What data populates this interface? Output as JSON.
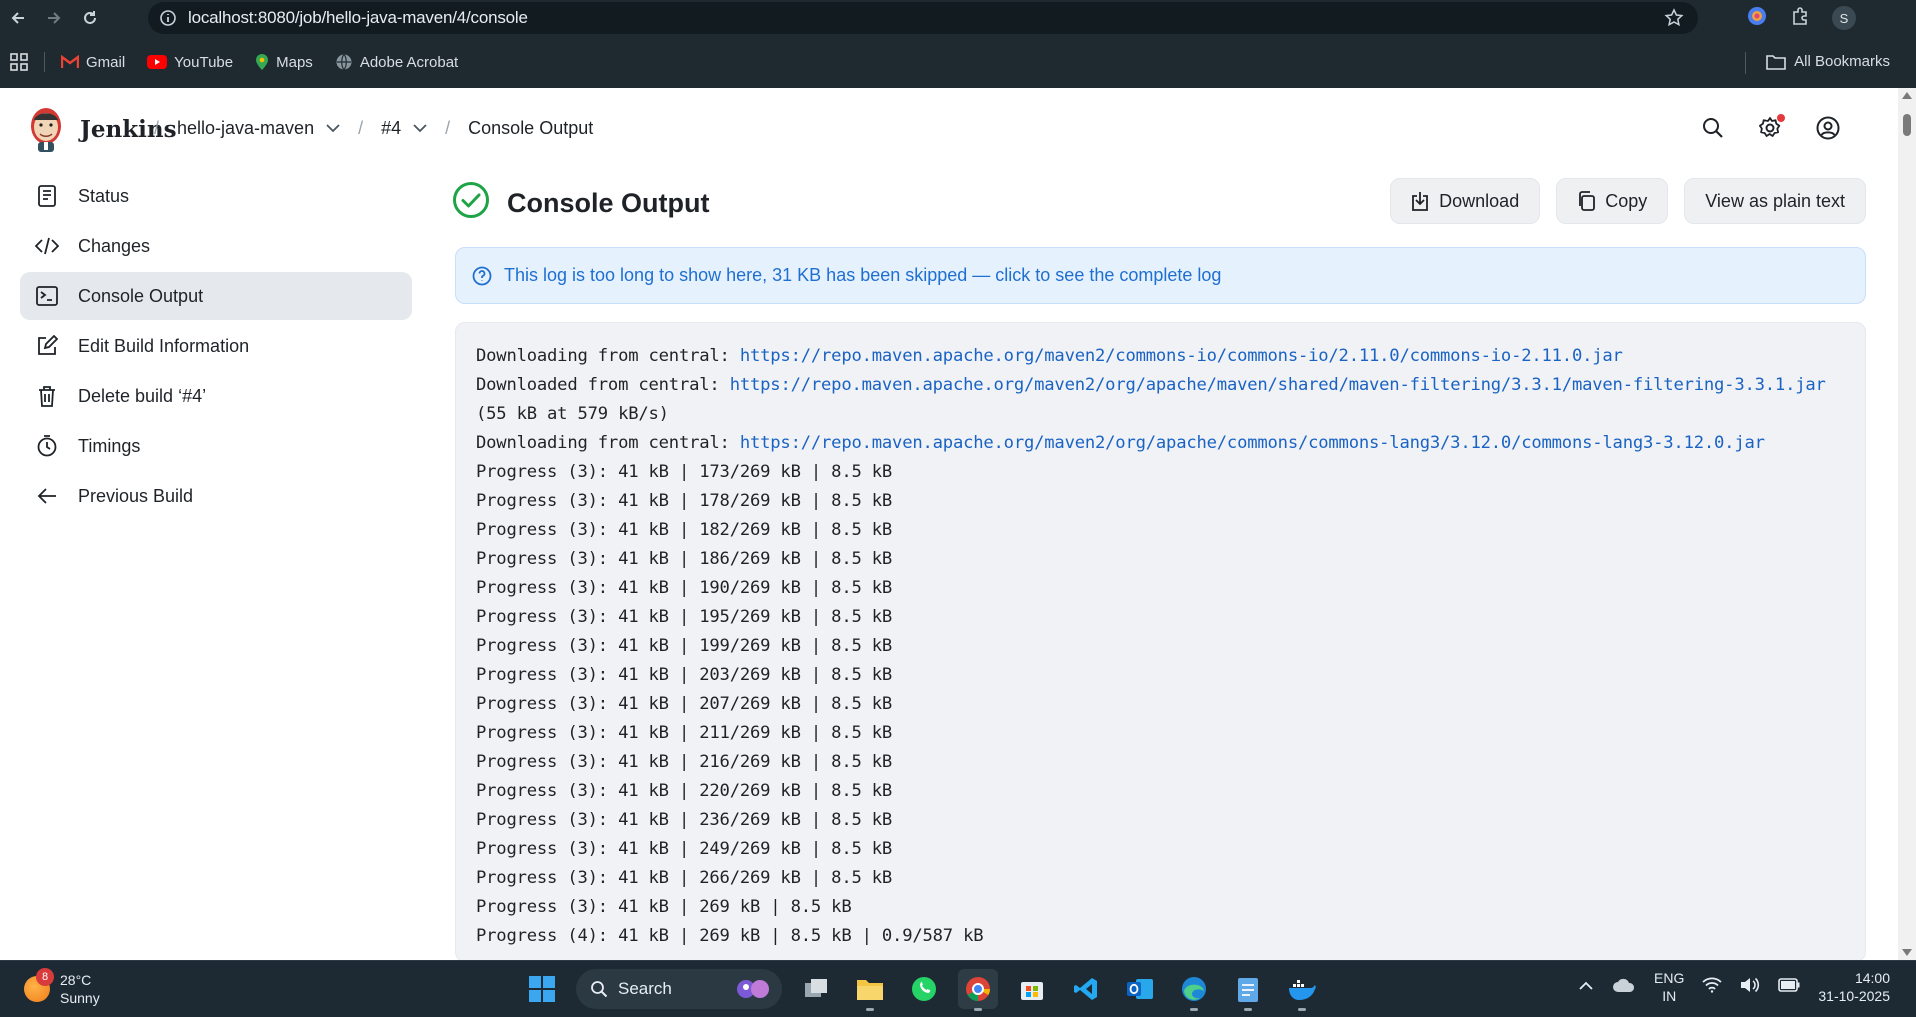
{
  "browser": {
    "url": "localhost:8080/job/hello-java-maven/4/console",
    "bookmarks": [
      "Gmail",
      "YouTube",
      "Maps",
      "Adobe Acrobat"
    ],
    "all_bookmarks": "All Bookmarks",
    "profile_initial": "S"
  },
  "header": {
    "app_name": "Jenkins",
    "breadcrumbs": [
      "hello-java-maven",
      "#4",
      "Console Output"
    ]
  },
  "sidebar": {
    "items": [
      {
        "label": "Status",
        "icon": "document-icon"
      },
      {
        "label": "Changes",
        "icon": "code-icon"
      },
      {
        "label": "Console Output",
        "icon": "terminal-icon",
        "active": true
      },
      {
        "label": "Edit Build Information",
        "icon": "edit-icon"
      },
      {
        "label": "Delete build ‘#4’",
        "icon": "trash-icon"
      },
      {
        "label": "Timings",
        "icon": "stopwatch-icon"
      },
      {
        "label": "Previous Build",
        "icon": "arrow-left-icon"
      }
    ]
  },
  "main": {
    "title": "Console Output",
    "status": "success",
    "buttons": {
      "download": "Download",
      "copy": "Copy",
      "plain": "View as plain text"
    },
    "notice": "This log is too long to show here, 31 KB has been skipped — click to see the complete log",
    "log": [
      {
        "text": "Downloading from central: ",
        "link": "https://repo.maven.apache.org/maven2/commons-io/commons-io/2.11.0/commons-io-2.11.0.jar"
      },
      {
        "text": "Downloaded from central: ",
        "link": "https://repo.maven.apache.org/maven2/org/apache/maven/shared/maven-filtering/3.3.1/maven-filtering-3.3.1.jar"
      },
      {
        "text": "(55 kB at 579 kB/s)",
        "link": ""
      },
      {
        "text": "Downloading from central: ",
        "link": "https://repo.maven.apache.org/maven2/org/apache/commons/commons-lang3/3.12.0/commons-lang3-3.12.0.jar"
      },
      {
        "text": "Progress (3): 41 kB | 173/269 kB | 8.5 kB",
        "link": ""
      },
      {
        "text": "Progress (3): 41 kB | 178/269 kB | 8.5 kB",
        "link": ""
      },
      {
        "text": "Progress (3): 41 kB | 182/269 kB | 8.5 kB",
        "link": ""
      },
      {
        "text": "Progress (3): 41 kB | 186/269 kB | 8.5 kB",
        "link": ""
      },
      {
        "text": "Progress (3): 41 kB | 190/269 kB | 8.5 kB",
        "link": ""
      },
      {
        "text": "Progress (3): 41 kB | 195/269 kB | 8.5 kB",
        "link": ""
      },
      {
        "text": "Progress (3): 41 kB | 199/269 kB | 8.5 kB",
        "link": ""
      },
      {
        "text": "Progress (3): 41 kB | 203/269 kB | 8.5 kB",
        "link": ""
      },
      {
        "text": "Progress (3): 41 kB | 207/269 kB | 8.5 kB",
        "link": ""
      },
      {
        "text": "Progress (3): 41 kB | 211/269 kB | 8.5 kB",
        "link": ""
      },
      {
        "text": "Progress (3): 41 kB | 216/269 kB | 8.5 kB",
        "link": ""
      },
      {
        "text": "Progress (3): 41 kB | 220/269 kB | 8.5 kB",
        "link": ""
      },
      {
        "text": "Progress (3): 41 kB | 236/269 kB | 8.5 kB",
        "link": ""
      },
      {
        "text": "Progress (3): 41 kB | 249/269 kB | 8.5 kB",
        "link": ""
      },
      {
        "text": "Progress (3): 41 kB | 266/269 kB | 8.5 kB",
        "link": ""
      },
      {
        "text": "Progress (3): 41 kB | 269 kB | 8.5 kB",
        "link": ""
      },
      {
        "text": "Progress (4): 41 kB | 269 kB | 8.5 kB | 0.9/587 kB",
        "link": ""
      }
    ]
  },
  "taskbar": {
    "weather_badge": "8",
    "temperature": "28°C",
    "condition": "Sunny",
    "search": "Search",
    "lang_1": "ENG",
    "lang_2": "IN",
    "time": "14:00",
    "date": "31-10-2025"
  },
  "colors": {
    "chrome": "#1f2a30",
    "link": "#1a63c4",
    "success": "#1ea446",
    "notice_bg": "#e6f1fe"
  }
}
